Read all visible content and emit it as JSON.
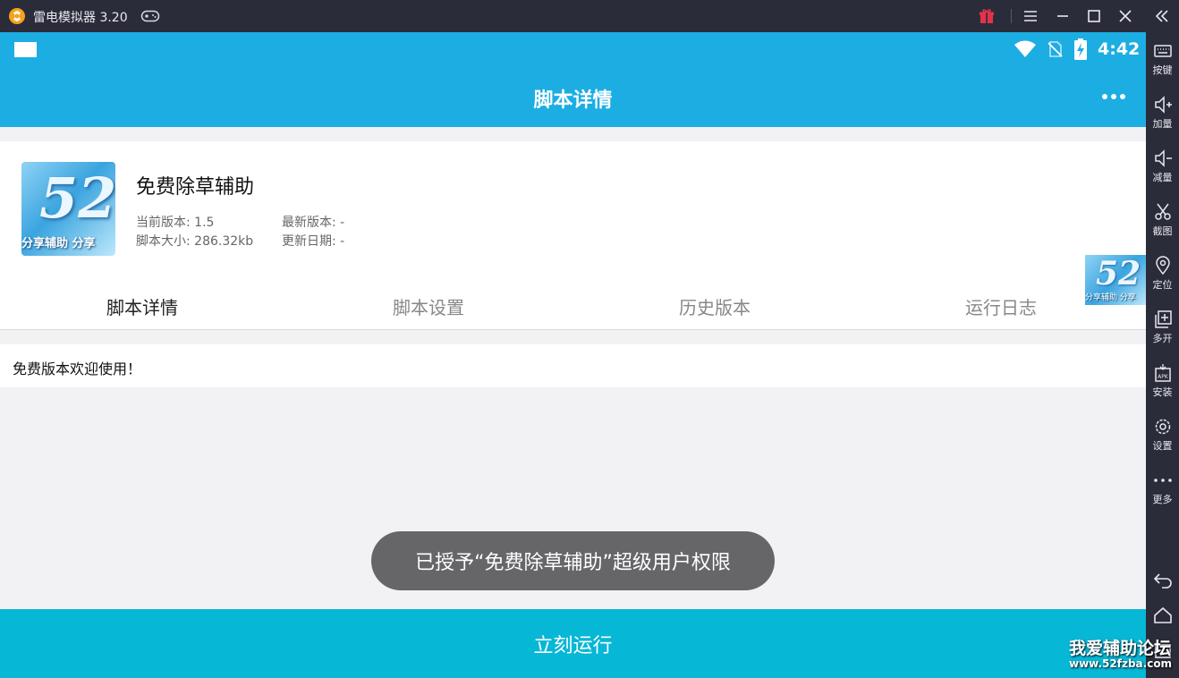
{
  "window": {
    "title": "雷电模拟器 3.20",
    "gift_color": "#e2334a",
    "accent": "#1cade3"
  },
  "statusbar": {
    "time": "4:42"
  },
  "appbar": {
    "title": "脚本详情"
  },
  "script": {
    "name": "免费除草辅助",
    "thumbnail_number": "52",
    "thumbnail_caption": "分享辅助 分享",
    "current_version": "当前版本:  1.5",
    "script_size": "脚本大小:  286.32kb",
    "latest_version": "最新版本:  -",
    "update_date": "更新日期:  -"
  },
  "tabs": [
    {
      "label": "脚本详情",
      "active": true
    },
    {
      "label": "脚本设置",
      "active": false
    },
    {
      "label": "历史版本",
      "active": false
    },
    {
      "label": "运行日志",
      "active": false
    }
  ],
  "content": {
    "text": "免费版本欢迎使用！"
  },
  "toast": {
    "text": "已授予“免费除草辅助”超级用户权限"
  },
  "run_button": {
    "label": "立刻运行",
    "color": "#06b7d6"
  },
  "floating_thumb": {
    "number": "52",
    "caption": "分享辅助  分享"
  },
  "sidebar": {
    "items": [
      {
        "label": "按键",
        "icon": "keyboard-icon"
      },
      {
        "label": "加量",
        "icon": "volume-up-icon"
      },
      {
        "label": "减量",
        "icon": "volume-down-icon"
      },
      {
        "label": "截图",
        "icon": "scissors-icon"
      },
      {
        "label": "定位",
        "icon": "location-icon"
      },
      {
        "label": "多开",
        "icon": "multi-instance-icon"
      },
      {
        "label": "安装",
        "icon": "apk-install-icon"
      },
      {
        "label": "设置",
        "icon": "gear-icon"
      },
      {
        "label": "更多",
        "icon": "more-dots-icon"
      }
    ]
  },
  "watermark": {
    "title": "我爱辅助论坛",
    "url": "www.52fzba.com"
  }
}
